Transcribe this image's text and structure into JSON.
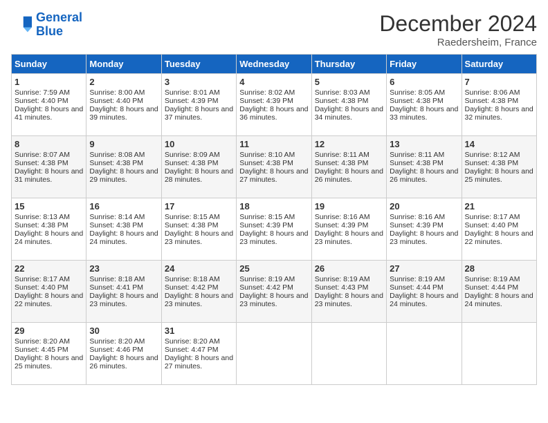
{
  "header": {
    "logo_line1": "General",
    "logo_line2": "Blue",
    "month": "December 2024",
    "location": "Raedersheim, France"
  },
  "days_of_week": [
    "Sunday",
    "Monday",
    "Tuesday",
    "Wednesday",
    "Thursday",
    "Friday",
    "Saturday"
  ],
  "weeks": [
    [
      {
        "day": "1",
        "sunrise": "7:59 AM",
        "sunset": "4:40 PM",
        "daylight": "8 hours and 41 minutes."
      },
      {
        "day": "2",
        "sunrise": "8:00 AM",
        "sunset": "4:40 PM",
        "daylight": "8 hours and 39 minutes."
      },
      {
        "day": "3",
        "sunrise": "8:01 AM",
        "sunset": "4:39 PM",
        "daylight": "8 hours and 37 minutes."
      },
      {
        "day": "4",
        "sunrise": "8:02 AM",
        "sunset": "4:39 PM",
        "daylight": "8 hours and 36 minutes."
      },
      {
        "day": "5",
        "sunrise": "8:03 AM",
        "sunset": "4:38 PM",
        "daylight": "8 hours and 34 minutes."
      },
      {
        "day": "6",
        "sunrise": "8:05 AM",
        "sunset": "4:38 PM",
        "daylight": "8 hours and 33 minutes."
      },
      {
        "day": "7",
        "sunrise": "8:06 AM",
        "sunset": "4:38 PM",
        "daylight": "8 hours and 32 minutes."
      }
    ],
    [
      {
        "day": "8",
        "sunrise": "8:07 AM",
        "sunset": "4:38 PM",
        "daylight": "8 hours and 31 minutes."
      },
      {
        "day": "9",
        "sunrise": "8:08 AM",
        "sunset": "4:38 PM",
        "daylight": "8 hours and 29 minutes."
      },
      {
        "day": "10",
        "sunrise": "8:09 AM",
        "sunset": "4:38 PM",
        "daylight": "8 hours and 28 minutes."
      },
      {
        "day": "11",
        "sunrise": "8:10 AM",
        "sunset": "4:38 PM",
        "daylight": "8 hours and 27 minutes."
      },
      {
        "day": "12",
        "sunrise": "8:11 AM",
        "sunset": "4:38 PM",
        "daylight": "8 hours and 26 minutes."
      },
      {
        "day": "13",
        "sunrise": "8:11 AM",
        "sunset": "4:38 PM",
        "daylight": "8 hours and 26 minutes."
      },
      {
        "day": "14",
        "sunrise": "8:12 AM",
        "sunset": "4:38 PM",
        "daylight": "8 hours and 25 minutes."
      }
    ],
    [
      {
        "day": "15",
        "sunrise": "8:13 AM",
        "sunset": "4:38 PM",
        "daylight": "8 hours and 24 minutes."
      },
      {
        "day": "16",
        "sunrise": "8:14 AM",
        "sunset": "4:38 PM",
        "daylight": "8 hours and 24 minutes."
      },
      {
        "day": "17",
        "sunrise": "8:15 AM",
        "sunset": "4:38 PM",
        "daylight": "8 hours and 23 minutes."
      },
      {
        "day": "18",
        "sunrise": "8:15 AM",
        "sunset": "4:39 PM",
        "daylight": "8 hours and 23 minutes."
      },
      {
        "day": "19",
        "sunrise": "8:16 AM",
        "sunset": "4:39 PM",
        "daylight": "8 hours and 23 minutes."
      },
      {
        "day": "20",
        "sunrise": "8:16 AM",
        "sunset": "4:39 PM",
        "daylight": "8 hours and 23 minutes."
      },
      {
        "day": "21",
        "sunrise": "8:17 AM",
        "sunset": "4:40 PM",
        "daylight": "8 hours and 22 minutes."
      }
    ],
    [
      {
        "day": "22",
        "sunrise": "8:17 AM",
        "sunset": "4:40 PM",
        "daylight": "8 hours and 22 minutes."
      },
      {
        "day": "23",
        "sunrise": "8:18 AM",
        "sunset": "4:41 PM",
        "daylight": "8 hours and 23 minutes."
      },
      {
        "day": "24",
        "sunrise": "8:18 AM",
        "sunset": "4:42 PM",
        "daylight": "8 hours and 23 minutes."
      },
      {
        "day": "25",
        "sunrise": "8:19 AM",
        "sunset": "4:42 PM",
        "daylight": "8 hours and 23 minutes."
      },
      {
        "day": "26",
        "sunrise": "8:19 AM",
        "sunset": "4:43 PM",
        "daylight": "8 hours and 23 minutes."
      },
      {
        "day": "27",
        "sunrise": "8:19 AM",
        "sunset": "4:44 PM",
        "daylight": "8 hours and 24 minutes."
      },
      {
        "day": "28",
        "sunrise": "8:19 AM",
        "sunset": "4:44 PM",
        "daylight": "8 hours and 24 minutes."
      }
    ],
    [
      {
        "day": "29",
        "sunrise": "8:20 AM",
        "sunset": "4:45 PM",
        "daylight": "8 hours and 25 minutes."
      },
      {
        "day": "30",
        "sunrise": "8:20 AM",
        "sunset": "4:46 PM",
        "daylight": "8 hours and 26 minutes."
      },
      {
        "day": "31",
        "sunrise": "8:20 AM",
        "sunset": "4:47 PM",
        "daylight": "8 hours and 27 minutes."
      },
      null,
      null,
      null,
      null
    ]
  ]
}
